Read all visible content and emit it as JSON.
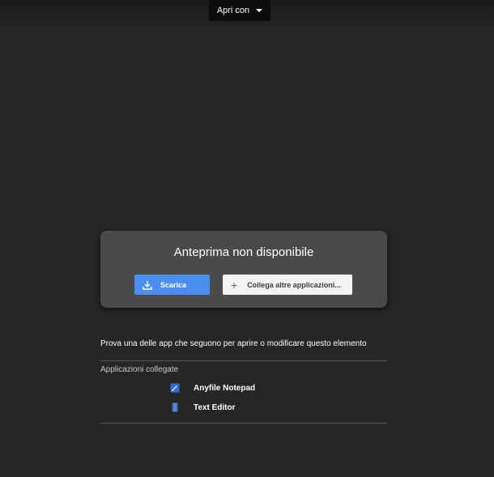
{
  "toolbar": {
    "open_with_label": "Apri con"
  },
  "preview_card": {
    "title": "Anteprima non disponibile",
    "download_label": "Scarica",
    "connect_label": "Collega altre applicazioni..."
  },
  "suggestions": {
    "text": "Prova una delle app che seguono per aprire o modificare questo elemento",
    "section_label": "Applicazioni collegate",
    "apps": [
      {
        "name": "Anyfile Notepad",
        "icon": "notepad-icon"
      },
      {
        "name": "Text Editor",
        "icon": "text-editor-icon"
      }
    ]
  },
  "colors": {
    "background": "#262626",
    "card": "#4a494b",
    "primary_button": "#4a8ef1",
    "secondary_button": "#f3f3f3"
  }
}
